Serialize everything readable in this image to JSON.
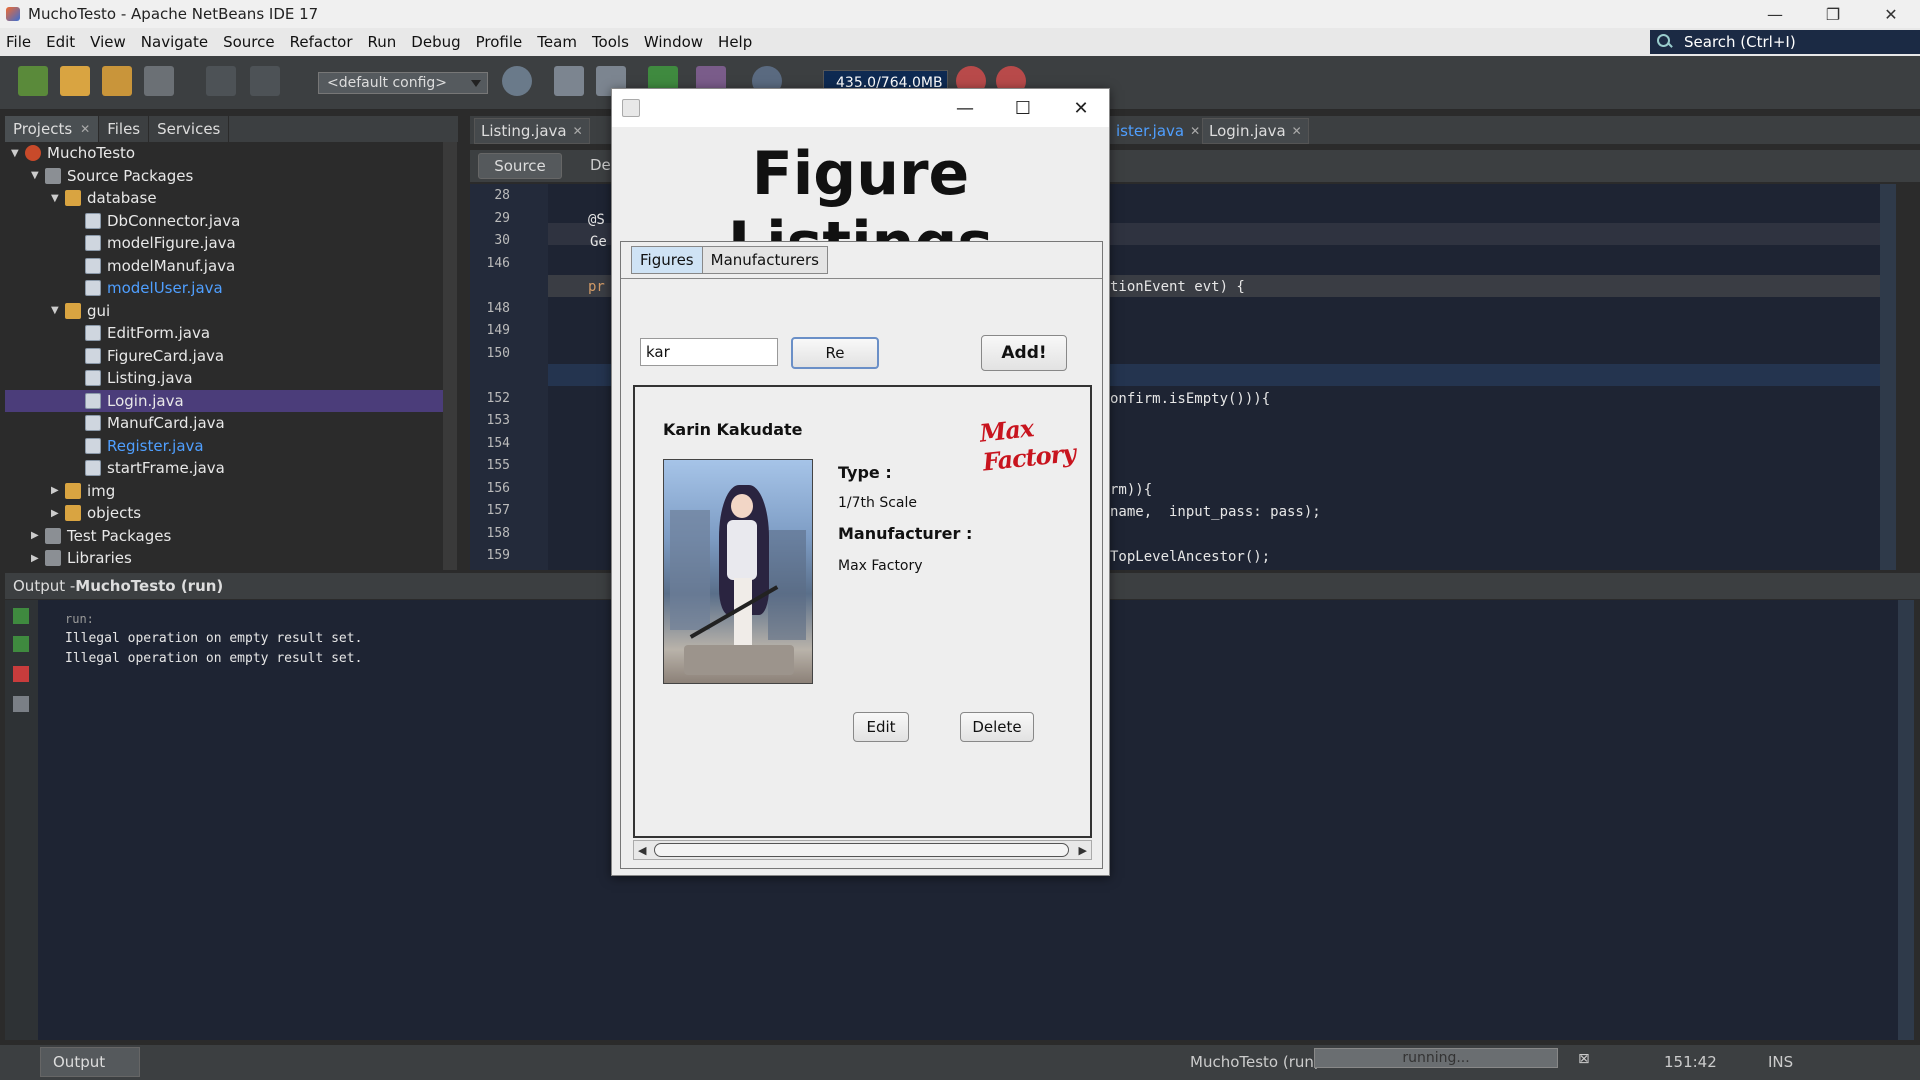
{
  "window": {
    "title": "MuchoTesto - Apache NetBeans IDE 17",
    "controls": [
      "—",
      "❐",
      "✕"
    ]
  },
  "menu": {
    "items": [
      "File",
      "Edit",
      "View",
      "Navigate",
      "Source",
      "Refactor",
      "Run",
      "Debug",
      "Profile",
      "Team",
      "Tools",
      "Window",
      "Help"
    ],
    "search_placeholder": "Search (Ctrl+I)"
  },
  "toolbar": {
    "config": "<default config>",
    "memory": "435.0/764.0MB"
  },
  "projects": {
    "tabs": [
      "Projects",
      "Files",
      "Services"
    ],
    "tree": [
      {
        "label": "MuchoTesto",
        "depth": 0,
        "type": "project",
        "expanded": true
      },
      {
        "label": "Source Packages",
        "depth": 1,
        "type": "pkgs",
        "expanded": true
      },
      {
        "label": "database",
        "depth": 2,
        "type": "folder",
        "expanded": true
      },
      {
        "label": "DbConnector.java",
        "depth": 3,
        "type": "file"
      },
      {
        "label": "modelFigure.java",
        "depth": 3,
        "type": "file"
      },
      {
        "label": "modelManuf.java",
        "depth": 3,
        "type": "file"
      },
      {
        "label": "modelUser.java",
        "depth": 3,
        "type": "file",
        "link": true
      },
      {
        "label": "gui",
        "depth": 2,
        "type": "folder",
        "expanded": true
      },
      {
        "label": "EditForm.java",
        "depth": 3,
        "type": "form"
      },
      {
        "label": "FigureCard.java",
        "depth": 3,
        "type": "form"
      },
      {
        "label": "Listing.java",
        "depth": 3,
        "type": "form"
      },
      {
        "label": "Login.java",
        "depth": 3,
        "type": "form",
        "selected": true
      },
      {
        "label": "ManufCard.java",
        "depth": 3,
        "type": "form"
      },
      {
        "label": "Register.java",
        "depth": 3,
        "type": "form",
        "link": true
      },
      {
        "label": "startFrame.java",
        "depth": 3,
        "type": "form"
      },
      {
        "label": "img",
        "depth": 2,
        "type": "folder",
        "expanded": false
      },
      {
        "label": "objects",
        "depth": 2,
        "type": "folder",
        "expanded": false
      },
      {
        "label": "Test Packages",
        "depth": 1,
        "type": "pkgs",
        "expanded": false
      },
      {
        "label": "Libraries",
        "depth": 1,
        "type": "pkgs",
        "expanded": false
      }
    ]
  },
  "editor": {
    "tabs": [
      "Listing.java",
      "ister.java",
      "Login.java"
    ],
    "source_label": "Source",
    "design_label": "De",
    "line_numbers": [
      "28",
      "29",
      "30",
      "146",
      "",
      "148",
      "149",
      "150",
      "",
      "152",
      "153",
      "154",
      "155",
      "156",
      "157",
      "158",
      "159"
    ],
    "code": {
      "l29": "@S",
      "l30": "Ge",
      "l147_left": "pr",
      "l147_right": "tionEvent evt) {",
      "l152": "onfirm.isEmpty())){",
      "l156": "rm)){",
      "l157": "name,  input_pass: pass);",
      "l159": "TopLevelAncestor();"
    }
  },
  "output": {
    "title_prefix": "Output - ",
    "title_bold": "MuchoTesto (run)",
    "lines": [
      "run:",
      "Illegal operation on empty result set.",
      "Illegal operation on empty result set."
    ]
  },
  "statusbar": {
    "output_tab": "Output",
    "run_label": "MuchoTesto (run)",
    "progress": "running...",
    "position": "151:42",
    "mode": "INS"
  },
  "dialog": {
    "heading": "Figure Listings",
    "tabs": [
      "Figures",
      "Manufacturers"
    ],
    "search_value": "kar",
    "refresh_label": "Re",
    "add_label": "Add!",
    "card": {
      "name": "Karin Kakudate",
      "brand_logo": "Max Factory",
      "type_label": "Type :",
      "type_value": "1/7th Scale",
      "manufacturer_label": "Manufacturer :",
      "manufacturer_value": "Max Factory",
      "edit_label": "Edit",
      "delete_label": "Delete"
    }
  }
}
